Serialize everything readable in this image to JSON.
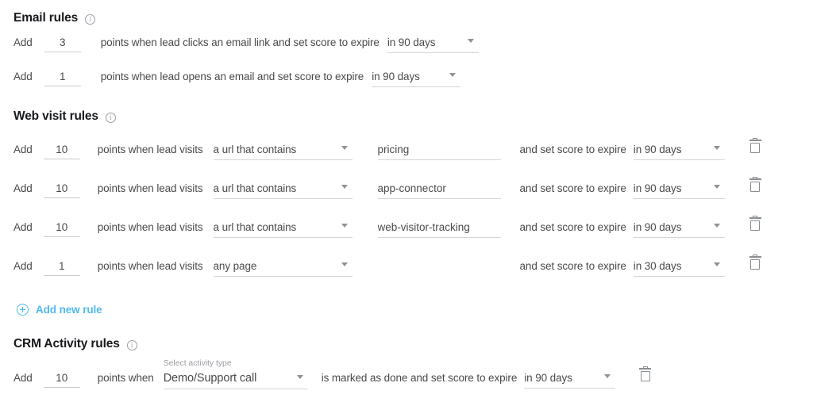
{
  "colors": {
    "accent": "#4fb9ef",
    "text": "#4a4a4a",
    "heading": "#17191c",
    "underline": "#d3d5d7",
    "icon": "#8a8d91"
  },
  "sections": {
    "email": {
      "title": "Email rules",
      "info_icon": "info-icon",
      "rows": [
        {
          "add_label": "Add",
          "points": "3",
          "middle_text": "points when lead clicks an email link and set score to expire",
          "expire": "in 90 days"
        },
        {
          "add_label": "Add",
          "points": "1",
          "middle_text": "points when lead opens an email and set score to expire",
          "expire": "in 90 days"
        }
      ]
    },
    "web_visit": {
      "title": "Web visit rules",
      "info_icon": "info-icon",
      "rows": [
        {
          "add_label": "Add",
          "points": "10",
          "middle_text": "points when lead visits",
          "condition": "a url that contains",
          "url_value": "pricing",
          "expire_text": "and set score to expire",
          "expire": "in 90 days",
          "delete_icon": "trash-icon"
        },
        {
          "add_label": "Add",
          "points": "10",
          "middle_text": "points when lead visits",
          "condition": "a url that contains",
          "url_value": "app-connector",
          "expire_text": "and set score to expire",
          "expire": "in 90 days",
          "delete_icon": "trash-icon"
        },
        {
          "add_label": "Add",
          "points": "10",
          "middle_text": "points when lead visits",
          "condition": "a url that contains",
          "url_value": "web-visitor-tracking",
          "expire_text": "and set score to expire",
          "expire": "in 90 days",
          "delete_icon": "trash-icon"
        },
        {
          "add_label": "Add",
          "points": "1",
          "middle_text": "points when lead visits",
          "condition": "any page",
          "url_value": "",
          "expire_text": "and set score to expire",
          "expire": "in 30 days",
          "delete_icon": "trash-icon"
        }
      ],
      "add_new_rule": {
        "label": "Add new rule",
        "icon": "plus-circle-icon"
      }
    },
    "crm_activity": {
      "title": "CRM Activity rules",
      "info_icon": "info-icon",
      "rows": [
        {
          "add_label": "Add",
          "points": "10",
          "middle_text": "points when",
          "activity_label": "Select activity type",
          "activity_type": "Demo/Support call",
          "tail_text": "is marked as done and set score to expire",
          "expire": "in 90 days",
          "delete_icon": "trash-icon"
        }
      ]
    }
  }
}
